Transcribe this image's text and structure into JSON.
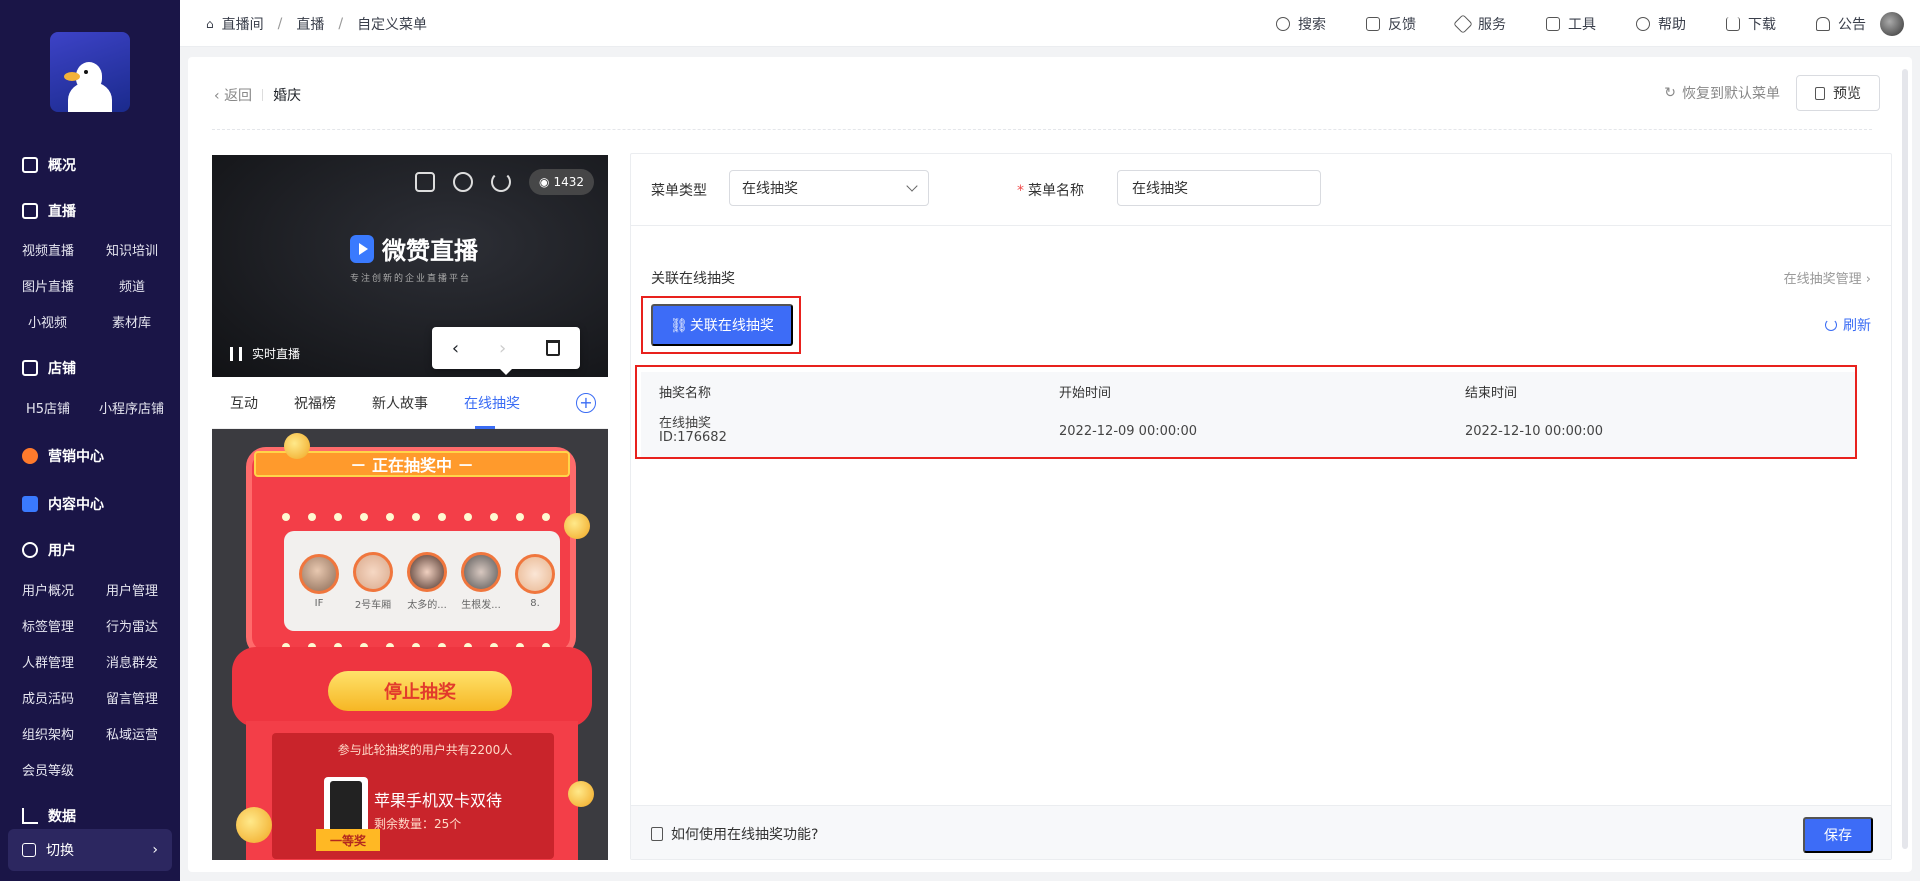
{
  "sidebar": {
    "sections": [
      {
        "label": "概况"
      },
      {
        "label": "直播"
      },
      {
        "label": "店铺"
      },
      {
        "label": "营销中心"
      },
      {
        "label": "内容中心"
      },
      {
        "label": "用户"
      },
      {
        "label": "数据"
      }
    ],
    "live_items": [
      "视频直播",
      "知识培训",
      "图片直播",
      "频道",
      "小视频",
      "素材库"
    ],
    "shop_items": [
      "H5店铺",
      "小程序店铺"
    ],
    "user_items": [
      "用户概况",
      "用户管理",
      "标签管理",
      "行为雷达",
      "人群管理",
      "消息群发",
      "成员活码",
      "留言管理",
      "组织架构",
      "私域运营",
      "会员等级"
    ],
    "switch_label": "切换"
  },
  "topbar": {
    "breadcrumb": [
      "直播间",
      "直播",
      "自定义菜单"
    ],
    "tools": [
      {
        "label": "搜索",
        "icon": "search-icon"
      },
      {
        "label": "反馈",
        "icon": "feedback-icon"
      },
      {
        "label": "服务",
        "icon": "service-icon"
      },
      {
        "label": "工具",
        "icon": "tools-icon"
      },
      {
        "label": "帮助",
        "icon": "help-icon"
      },
      {
        "label": "下载",
        "icon": "download-icon"
      },
      {
        "label": "公告",
        "icon": "bell-icon"
      }
    ]
  },
  "header": {
    "back_label": "返回",
    "page_title": "婚庆",
    "restore_label": "恢复到默认菜单",
    "preview_label": "预览"
  },
  "phone": {
    "views": "1432",
    "brand": "微赞直播",
    "brand_sub": "专注创新的企业直播平台",
    "live_label": "实时直播",
    "tabs": [
      "互动",
      "祝福榜",
      "新人故事",
      "在线抽奖"
    ],
    "active_tab": "在线抽奖",
    "lottery": {
      "banner": "－ 正在抽奖中 －",
      "users": [
        "IF",
        "2号车厢",
        "太多的...",
        "生根发...",
        "8."
      ],
      "stop_label": "停止抽奖",
      "participants": "参与此轮抽奖的用户共有2200人",
      "prize_name": "苹果手机双卡双待",
      "prize_remaining": "剩余数量：25个",
      "prize_tier": "一等奖"
    }
  },
  "form": {
    "menu_type_label": "菜单类型",
    "menu_type_value": "在线抽奖",
    "menu_name_label": "菜单名称",
    "menu_name_value": "在线抽奖"
  },
  "lottery_section": {
    "title": "关联在线抽奖",
    "manage_link": "在线抽奖管理",
    "link_button": "关联在线抽奖",
    "refresh_label": "刷新",
    "columns": [
      "抽奖名称",
      "开始时间",
      "结束时间"
    ],
    "rows": [
      {
        "name": "在线抽奖",
        "id": "ID:176682",
        "start": "2022-12-09 00:00:00",
        "end": "2022-12-10 00:00:00"
      }
    ]
  },
  "footer": {
    "help_label": "如何使用在线抽奖功能?",
    "save_label": "保存"
  },
  "colors": {
    "sidebar_bg": "#1a1547",
    "primary": "#3d6cf7",
    "highlight_border": "#e8211d"
  }
}
